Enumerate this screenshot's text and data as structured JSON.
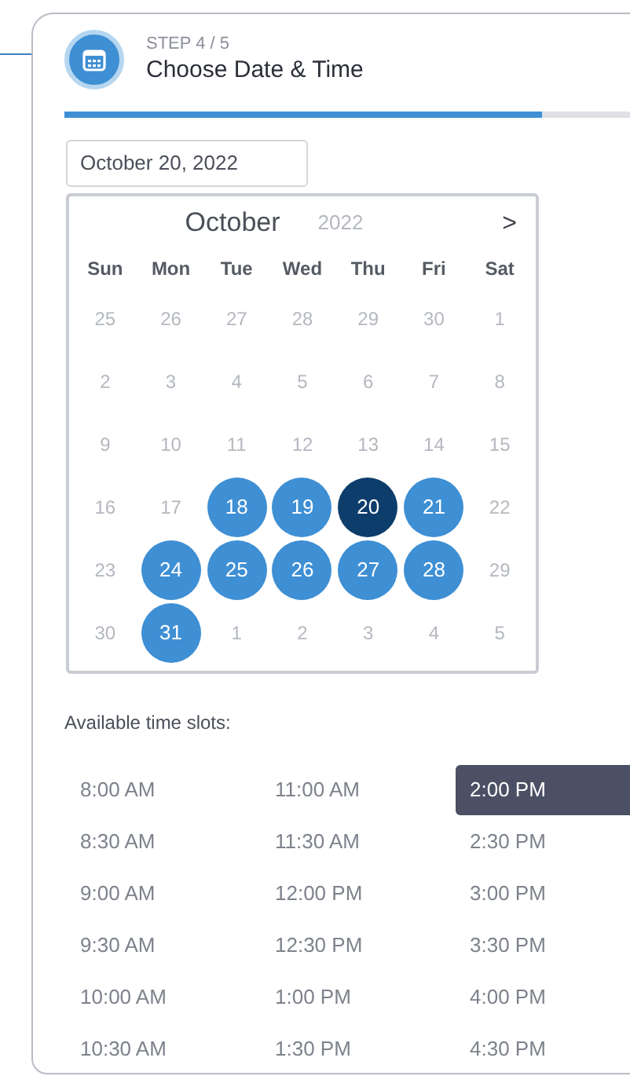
{
  "step": {
    "label": "STEP 4 / 5",
    "title": "Choose Date & Time",
    "level": 0.8
  },
  "date_field": {
    "value": "October 20, 2022"
  },
  "calendar": {
    "month": "October",
    "year": "2022",
    "next": ">",
    "weekdays": [
      "Sun",
      "Mon",
      "Tue",
      "Wed",
      "Thu",
      "Fri",
      "Sat"
    ],
    "days": [
      {
        "label": "25",
        "available": false,
        "selected": false
      },
      {
        "label": "26",
        "available": false,
        "selected": false
      },
      {
        "label": "27",
        "available": false,
        "selected": false
      },
      {
        "label": "28",
        "available": false,
        "selected": false
      },
      {
        "label": "29",
        "available": false,
        "selected": false
      },
      {
        "label": "30",
        "available": false,
        "selected": false
      },
      {
        "label": "1",
        "available": false,
        "selected": false
      },
      {
        "label": "2",
        "available": false,
        "selected": false
      },
      {
        "label": "3",
        "available": false,
        "selected": false
      },
      {
        "label": "4",
        "available": false,
        "selected": false
      },
      {
        "label": "5",
        "available": false,
        "selected": false
      },
      {
        "label": "6",
        "available": false,
        "selected": false
      },
      {
        "label": "7",
        "available": false,
        "selected": false
      },
      {
        "label": "8",
        "available": false,
        "selected": false
      },
      {
        "label": "9",
        "available": false,
        "selected": false
      },
      {
        "label": "10",
        "available": false,
        "selected": false
      },
      {
        "label": "11",
        "available": false,
        "selected": false
      },
      {
        "label": "12",
        "available": false,
        "selected": false
      },
      {
        "label": "13",
        "available": false,
        "selected": false
      },
      {
        "label": "14",
        "available": false,
        "selected": false
      },
      {
        "label": "15",
        "available": false,
        "selected": false
      },
      {
        "label": "16",
        "available": false,
        "selected": false
      },
      {
        "label": "17",
        "available": false,
        "selected": false
      },
      {
        "label": "18",
        "available": true,
        "selected": false
      },
      {
        "label": "19",
        "available": true,
        "selected": false
      },
      {
        "label": "20",
        "available": true,
        "selected": true
      },
      {
        "label": "21",
        "available": true,
        "selected": false
      },
      {
        "label": "22",
        "available": false,
        "selected": false
      },
      {
        "label": "23",
        "available": false,
        "selected": false
      },
      {
        "label": "24",
        "available": true,
        "selected": false
      },
      {
        "label": "25",
        "available": true,
        "selected": false
      },
      {
        "label": "26",
        "available": true,
        "selected": false
      },
      {
        "label": "27",
        "available": true,
        "selected": false
      },
      {
        "label": "28",
        "available": true,
        "selected": false
      },
      {
        "label": "29",
        "available": false,
        "selected": false
      },
      {
        "label": "30",
        "available": false,
        "selected": false
      },
      {
        "label": "31",
        "available": true,
        "selected": false
      },
      {
        "label": "1",
        "available": false,
        "selected": false
      },
      {
        "label": "2",
        "available": false,
        "selected": false
      },
      {
        "label": "3",
        "available": false,
        "selected": false
      },
      {
        "label": "4",
        "available": false,
        "selected": false
      },
      {
        "label": "5",
        "available": false,
        "selected": false
      }
    ]
  },
  "time_slots": {
    "heading": "Available time slots:",
    "columns": [
      [
        {
          "label": "8:00 AM",
          "selected": false
        },
        {
          "label": "8:30 AM",
          "selected": false
        },
        {
          "label": "9:00 AM",
          "selected": false
        },
        {
          "label": "9:30 AM",
          "selected": false
        },
        {
          "label": "10:00 AM",
          "selected": false
        },
        {
          "label": "10:30 AM",
          "selected": false
        }
      ],
      [
        {
          "label": "11:00 AM",
          "selected": false
        },
        {
          "label": "11:30 AM",
          "selected": false
        },
        {
          "label": "12:00 PM",
          "selected": false
        },
        {
          "label": "12:30 PM",
          "selected": false
        },
        {
          "label": "1:00 PM",
          "selected": false
        },
        {
          "label": "1:30 PM",
          "selected": false
        }
      ],
      [
        {
          "label": "2:00 PM",
          "selected": true
        },
        {
          "label": "2:30 PM",
          "selected": false
        },
        {
          "label": "3:00 PM",
          "selected": false
        },
        {
          "label": "3:30 PM",
          "selected": false
        },
        {
          "label": "4:00 PM",
          "selected": false
        },
        {
          "label": "4:30 PM",
          "selected": false
        }
      ]
    ]
  }
}
